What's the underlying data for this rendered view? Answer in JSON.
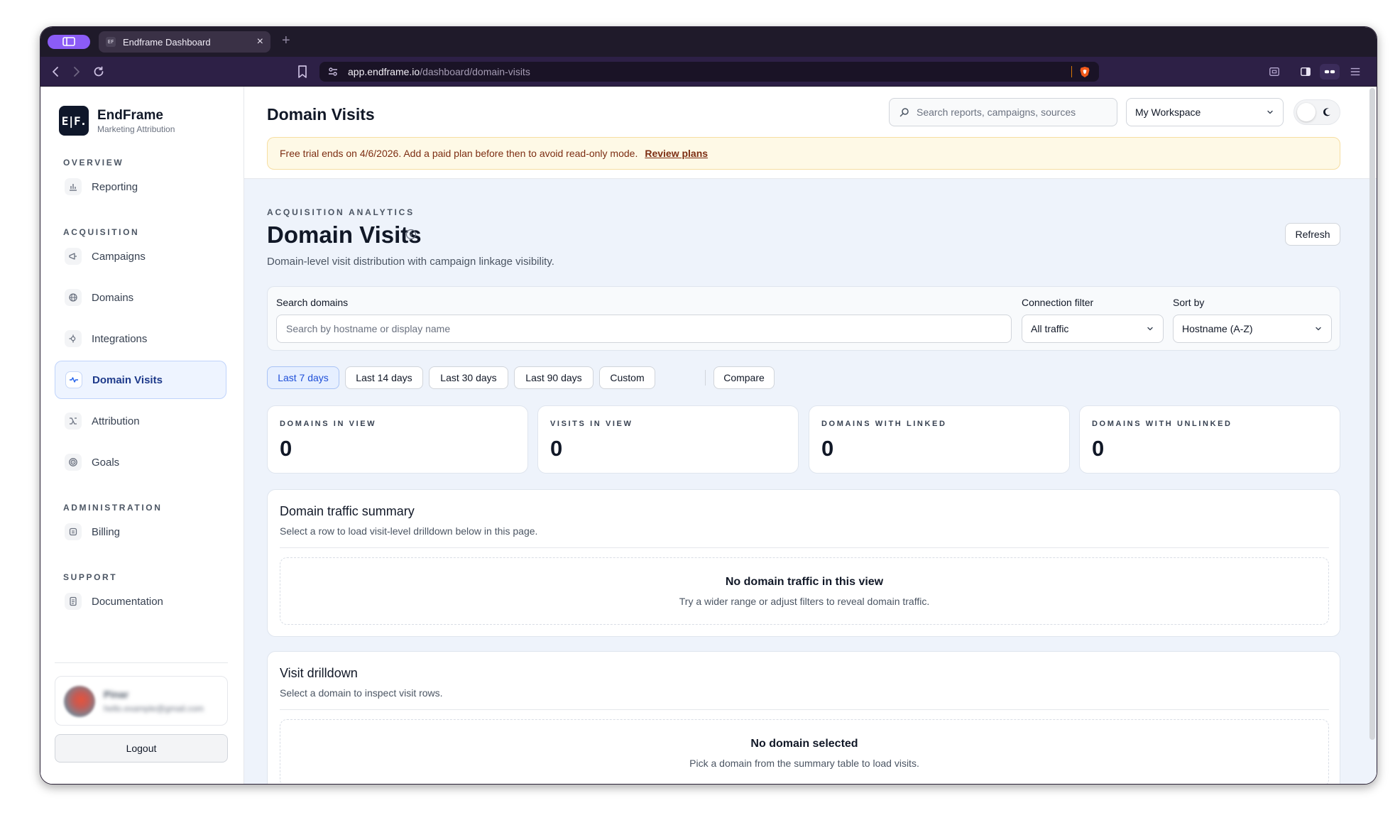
{
  "browser": {
    "tab_title": "Endframe Dashboard",
    "tab_favicon_text": "EF",
    "url_host": "app.endframe.io",
    "url_path": "/dashboard/domain-visits"
  },
  "sidebar": {
    "brand_logo": "E|F.",
    "brand_name": "EndFrame",
    "brand_sub": "Marketing Attribution",
    "sections": {
      "overview": "OVERVIEW",
      "acquisition": "ACQUISITION",
      "administration": "ADMINISTRATION",
      "support": "SUPPORT"
    },
    "items": {
      "reporting": "Reporting",
      "campaigns": "Campaigns",
      "domains": "Domains",
      "integrations": "Integrations",
      "domain_visits": "Domain Visits",
      "attribution": "Attribution",
      "goals": "Goals",
      "billing": "Billing",
      "documentation": "Documentation"
    },
    "user": {
      "name": "Pinar",
      "email": "hello.example@gmail.com"
    },
    "logout_label": "Logout"
  },
  "header": {
    "title": "Domain Visits",
    "search_placeholder": "Search reports, campaigns, sources",
    "workspace": "My Workspace"
  },
  "banner": {
    "text": "Free trial ends on 4/6/2026. Add a paid plan before then to avoid read-only mode.",
    "link": "Review plans"
  },
  "page": {
    "eyebrow": "ACQUISITION ANALYTICS",
    "title": "Domain Visits",
    "subtitle": "Domain-level visit distribution with campaign linkage visibility.",
    "refresh_label": "Refresh"
  },
  "filters": {
    "search_label": "Search domains",
    "search_placeholder": "Search by hostname or display name",
    "connection_label": "Connection filter",
    "connection_value": "All traffic",
    "sort_label": "Sort by",
    "sort_value": "Hostname (A-Z)"
  },
  "ranges": {
    "r7": "Last 7 days",
    "r14": "Last 14 days",
    "r30": "Last 30 days",
    "r90": "Last 90 days",
    "custom": "Custom",
    "compare": "Compare",
    "selected": "Last 7 days"
  },
  "stats": [
    {
      "label": "DOMAINS IN VIEW",
      "value": "0"
    },
    {
      "label": "VISITS IN VIEW",
      "value": "0"
    },
    {
      "label": "DOMAINS WITH LINKED",
      "value": "0"
    },
    {
      "label": "DOMAINS WITH UNLINKED",
      "value": "0"
    }
  ],
  "summary": {
    "title": "Domain traffic summary",
    "desc": "Select a row to load visit-level drilldown below in this page.",
    "empty_title": "No domain traffic in this view",
    "empty_desc": "Try a wider range or adjust filters to reveal domain traffic."
  },
  "drilldown": {
    "title": "Visit drilldown",
    "desc": "Select a domain to inspect visit rows.",
    "empty_title": "No domain selected",
    "empty_desc": "Pick a domain from the summary table to load visits."
  }
}
